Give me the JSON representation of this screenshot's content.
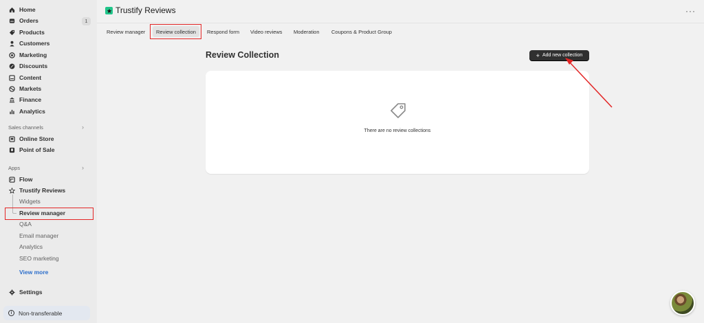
{
  "sidebar": {
    "main_items": [
      {
        "label": "Home",
        "icon": "home-icon"
      },
      {
        "label": "Orders",
        "icon": "orders-icon",
        "badge": "1"
      },
      {
        "label": "Products",
        "icon": "tag-icon"
      },
      {
        "label": "Customers",
        "icon": "person-icon"
      },
      {
        "label": "Marketing",
        "icon": "target-icon"
      },
      {
        "label": "Discounts",
        "icon": "discount-icon"
      },
      {
        "label": "Content",
        "icon": "content-icon"
      },
      {
        "label": "Markets",
        "icon": "globe-icon"
      },
      {
        "label": "Finance",
        "icon": "bank-icon"
      },
      {
        "label": "Analytics",
        "icon": "bar-chart-icon"
      }
    ],
    "sales_channels_label": "Sales channels",
    "sales_channels": [
      {
        "label": "Online Store",
        "icon": "store-icon"
      },
      {
        "label": "Point of Sale",
        "icon": "pos-icon"
      }
    ],
    "apps_label": "Apps",
    "apps": [
      {
        "label": "Flow",
        "icon": "flow-icon"
      },
      {
        "label": "Trustify Reviews",
        "icon": "star-icon"
      }
    ],
    "app_sub_items": [
      {
        "label": "Widgets"
      },
      {
        "label": "Review manager"
      },
      {
        "label": "Q&A"
      },
      {
        "label": "Email manager"
      },
      {
        "label": "Analytics"
      },
      {
        "label": "SEO marketing"
      }
    ],
    "view_more": "View more",
    "settings": "Settings",
    "non_transferable": "Non-transferable"
  },
  "header": {
    "app_title": "Trustify Reviews",
    "more": "···"
  },
  "tabs": [
    {
      "label": "Review manager"
    },
    {
      "label": "Review collection",
      "active": true
    },
    {
      "label": "Respond form"
    },
    {
      "label": "Video reviews"
    },
    {
      "label": "Moderation"
    },
    {
      "label": "Coupons & Product Group"
    }
  ],
  "main": {
    "title": "Review Collection",
    "add_button": "Add new collection",
    "empty_text": "There are no review collections"
  },
  "colors": {
    "brand": "#21c58a",
    "annotation": "#e32525",
    "button": "#303030"
  }
}
